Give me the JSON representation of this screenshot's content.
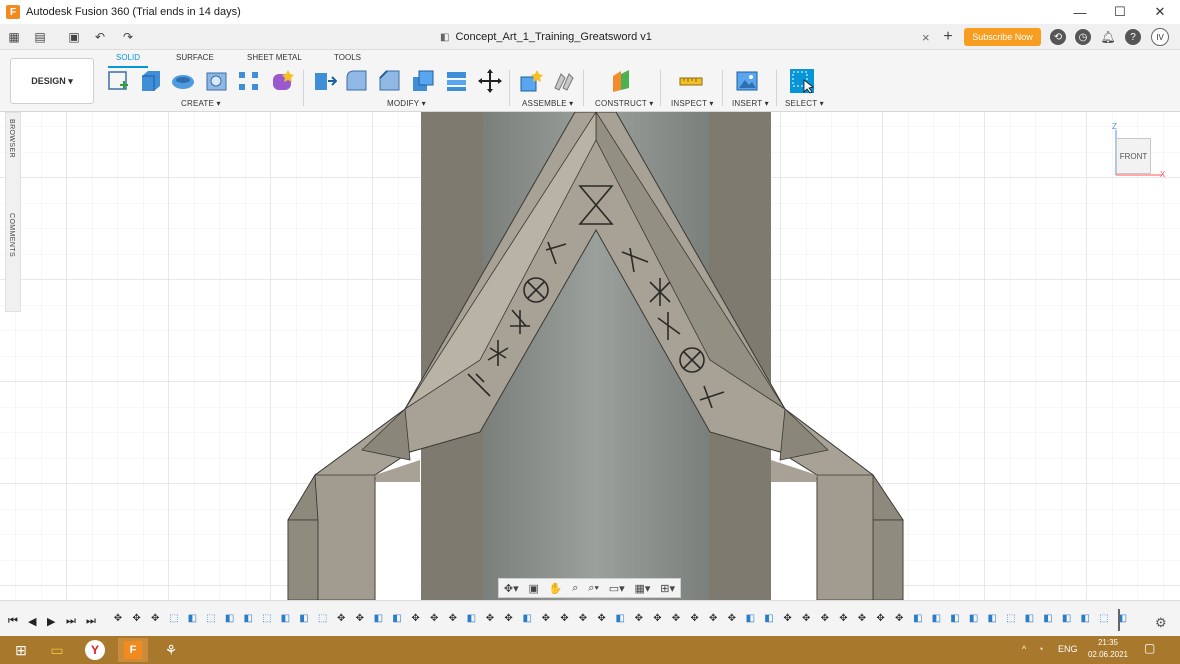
{
  "window": {
    "title": "Autodesk Fusion 360 (Trial ends in 14 days)",
    "app_icon": "F",
    "minimize": "—",
    "maximize": "☐",
    "close": "✕"
  },
  "toolbar": {
    "document_title": "Concept_Art_1_Training_Greatsword v1",
    "doc_close": "×",
    "new_tab": "+",
    "subscribe_label": "Subscribe Now",
    "user_initials": "IV"
  },
  "ribbon": {
    "workspace_label": "DESIGN ▾",
    "tabs": [
      "SOLID",
      "SURFACE",
      "SHEET METAL",
      "TOOLS"
    ],
    "active_tab": "SOLID",
    "groups": [
      "CREATE ▾",
      "MODIFY ▾",
      "ASSEMBLE ▾",
      "CONSTRUCT ▾",
      "INSPECT ▾",
      "INSERT ▾",
      "SELECT ▾"
    ]
  },
  "side_panel": {
    "browser_label": "BROWSER",
    "comments_label": "COMMENTS"
  },
  "viewcube": {
    "face_label": "FRONT",
    "z_label": "Z",
    "x_label": "X"
  },
  "timeline": {
    "controls": [
      "⏮",
      "◀",
      "▶",
      "⏭"
    ]
  },
  "taskbar": {
    "language": "ENG",
    "time": "21:35",
    "date": "02.06.2021"
  },
  "colors": {
    "accent": "#0696d7",
    "subscribe": "#f79d1f",
    "taskbar": "#a8782c",
    "model_dark": "#7e7a6f",
    "model_light": "#a9a498",
    "model_inner": "#8e938f"
  }
}
